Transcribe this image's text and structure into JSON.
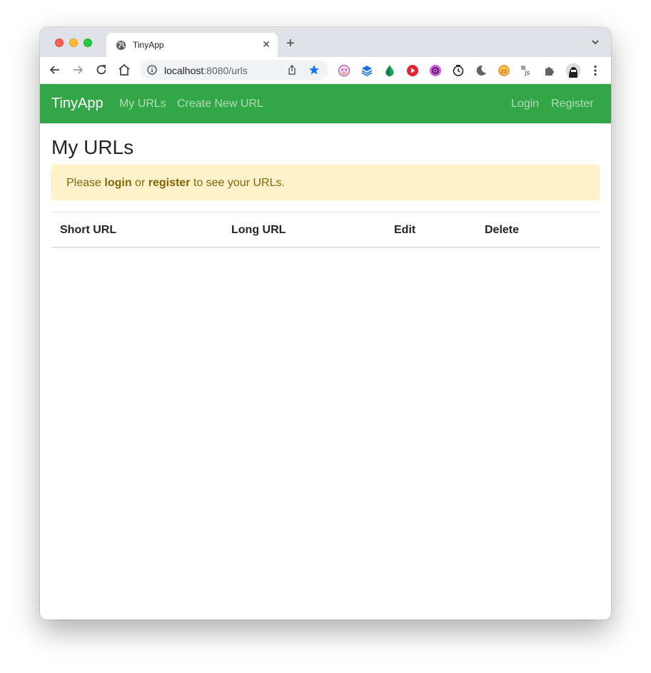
{
  "browser": {
    "tab_title": "TinyApp",
    "url_host": "localhost",
    "url_path": ":8080/urls",
    "extensions": [
      "cat-extension-icon",
      "layers-icon",
      "drop-icon",
      "youtube-icon",
      "music-icon",
      "clock-icon",
      "moon-icon",
      "zzz-icon",
      "js-icon",
      "puzzle-icon",
      "profile-avatar"
    ]
  },
  "navbar": {
    "brand": "TinyApp",
    "links": [
      "My URLs",
      "Create New URL"
    ],
    "right_links": [
      "Login",
      "Register"
    ],
    "color": "#33a748"
  },
  "page": {
    "title": "My URLs",
    "alert": {
      "prefix": "Please ",
      "login": "login",
      "middle": " or ",
      "register": "register",
      "suffix": " to see your URLs."
    },
    "table": {
      "headers": [
        "Short URL",
        "Long URL",
        "Edit",
        "Delete"
      ]
    }
  }
}
